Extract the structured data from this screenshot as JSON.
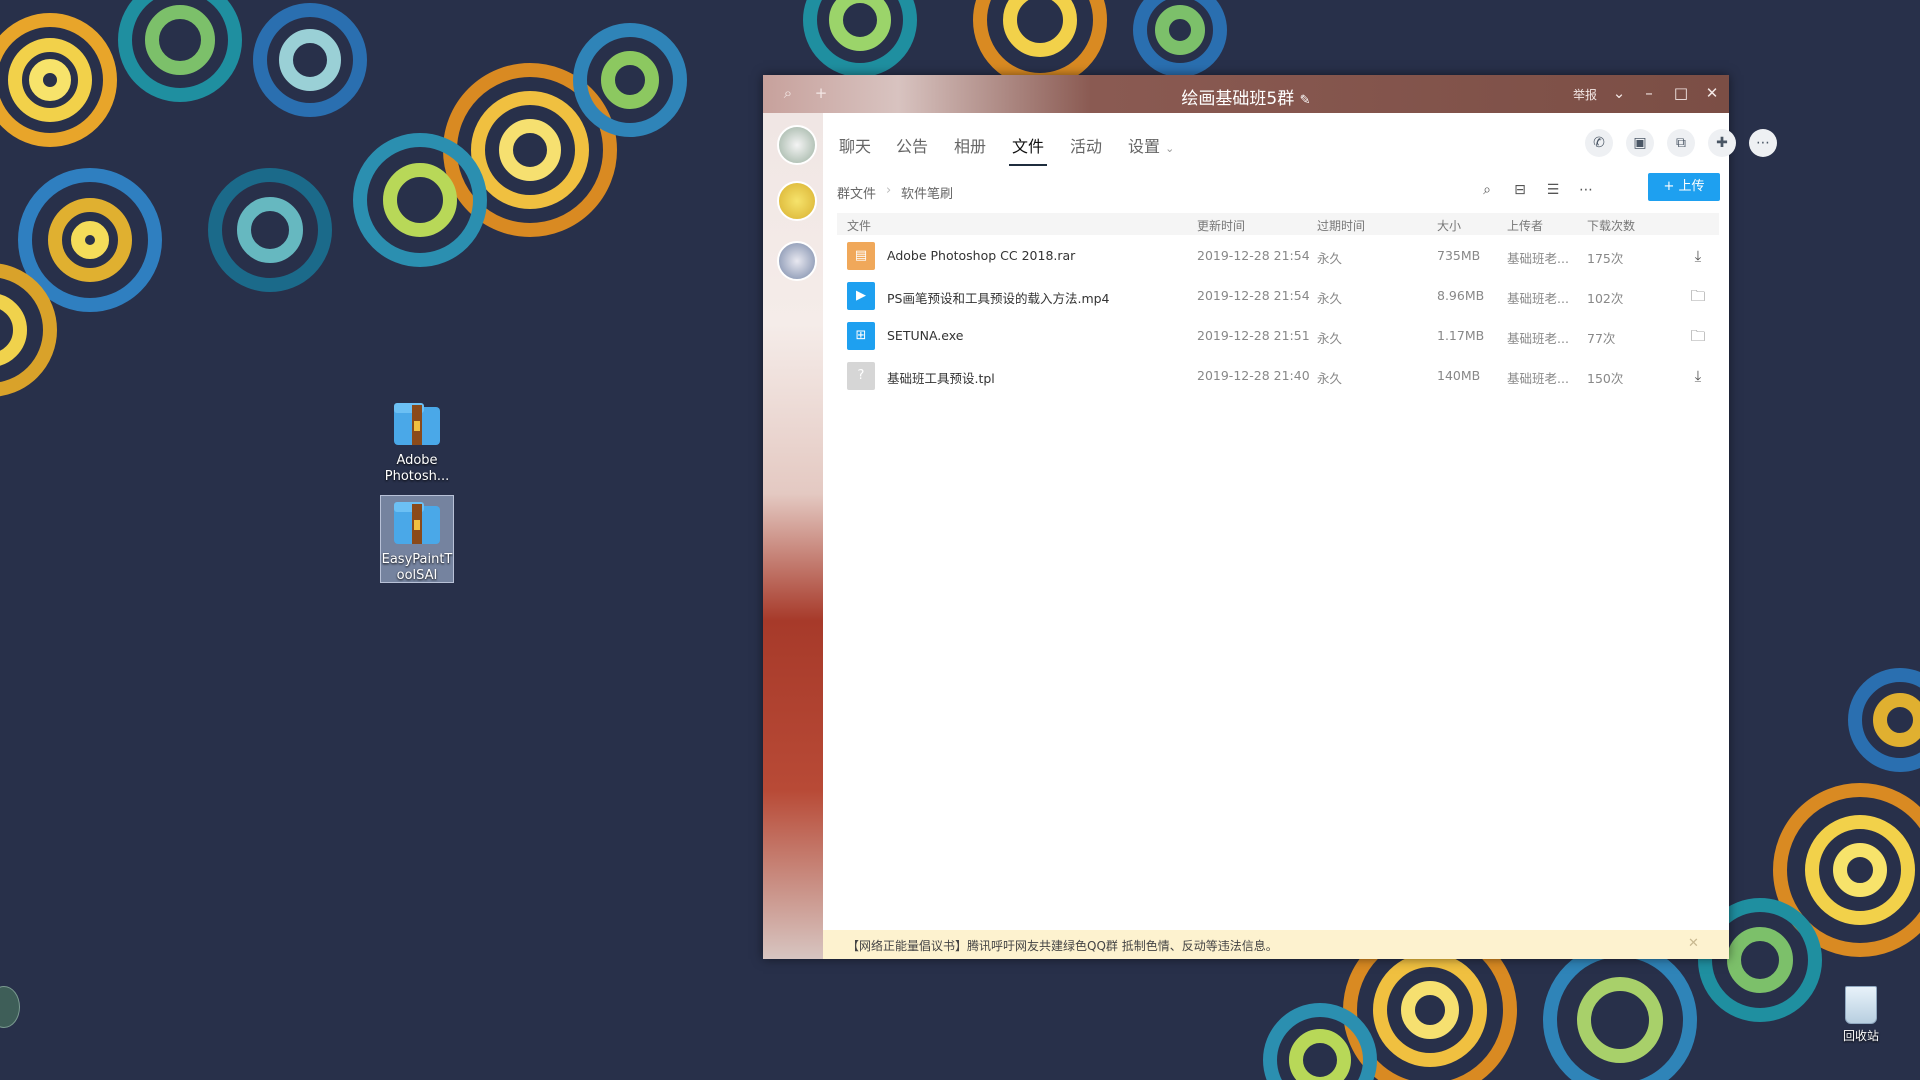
{
  "desktop": {
    "icons": [
      {
        "label": "Adobe Photosh..."
      },
      {
        "label": "EasyPaintToolSAI"
      }
    ],
    "recycle_bin": {
      "label": "回收站"
    }
  },
  "window": {
    "title": "绘画基础班5群",
    "report_label": "举报",
    "tabs": [
      {
        "label": "聊天"
      },
      {
        "label": "公告"
      },
      {
        "label": "相册"
      },
      {
        "label": "文件"
      },
      {
        "label": "活动"
      },
      {
        "label": "设置"
      }
    ],
    "active_tab": "文件",
    "breadcrumb": {
      "root": "群文件",
      "current": "软件笔刷"
    },
    "upload_label": "上传",
    "columns": {
      "name": "文件",
      "updated": "更新时间",
      "expires": "过期时间",
      "size": "大小",
      "uploader": "上传者",
      "downloads": "下载次数"
    },
    "files": [
      {
        "name": "Adobe Photoshop CC 2018.rar",
        "updated": "2019-12-28 21:54",
        "expires": "永久",
        "size": "735MB",
        "uploader": "基础班老...",
        "downloads": "175次",
        "icon": "archive-icon",
        "color": "#f0a85a",
        "action": "download-icon"
      },
      {
        "name": "PS画笔预设和工具预设的载入方法.mp4",
        "updated": "2019-12-28 21:54",
        "expires": "永久",
        "size": "8.96MB",
        "uploader": "基础班老...",
        "downloads": "102次",
        "icon": "video-icon",
        "color": "#1ea0f0",
        "action": "folder-icon"
      },
      {
        "name": "SETUNA.exe",
        "updated": "2019-12-28 21:51",
        "expires": "永久",
        "size": "1.17MB",
        "uploader": "基础班老...",
        "downloads": "77次",
        "icon": "windows-icon",
        "color": "#1ea0f0",
        "action": "folder-icon"
      },
      {
        "name": "基础班工具预设.tpl",
        "updated": "2019-12-28 21:40",
        "expires": "永久",
        "size": "140MB",
        "uploader": "基础班老...",
        "downloads": "150次",
        "icon": "unknown-file-icon",
        "color": "#d6d6d6",
        "action": "download-icon"
      }
    ],
    "notice": "【网络正能量倡议书】腾讯呼吁网友共建绿色QQ群 抵制色情、反动等违法信息。"
  },
  "colors": {
    "accent": "#1ea0f0",
    "desktop_bg": "#28304a",
    "notice_bg": "#fdf2cf"
  }
}
